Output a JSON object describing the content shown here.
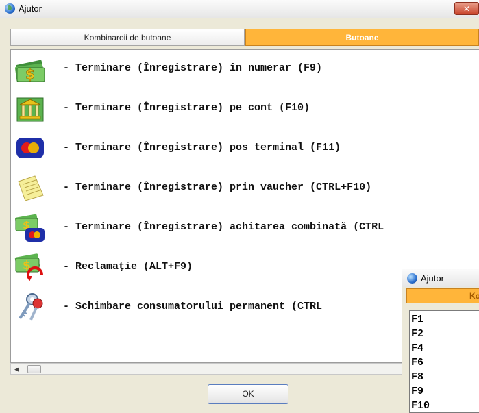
{
  "window": {
    "title": "Ajutor",
    "close_label": "✕"
  },
  "tabs": [
    {
      "label": "Kombinaroii de butoane",
      "active": false
    },
    {
      "label": "Butoane",
      "active": true
    }
  ],
  "rows": [
    {
      "icon": "cash-icon",
      "text": "- Terminare (Înregistrare) în numerar (F9)"
    },
    {
      "icon": "bank-icon",
      "text": "- Terminare (Înregistrare) pe cont (F10)"
    },
    {
      "icon": "card-icon",
      "text": "- Terminare (Înregistrare) pos terminal (F11)"
    },
    {
      "icon": "voucher-icon",
      "text": "- Terminare (Înregistrare) prin vaucher (CTRL+F10)"
    },
    {
      "icon": "combined-payment-icon",
      "text": "- Terminare (Înregistrare) achitarea combinată (CTRL"
    },
    {
      "icon": "refund-icon",
      "text": "- Reclamaţie (ALT+F9)"
    },
    {
      "icon": "keys-icon",
      "text": "- Schimbare consumatorului permanent (CTRL"
    }
  ],
  "ok_label": "OK",
  "colors": {
    "active_tab": "#ffb53a",
    "title_bar": "#f0f0f0"
  },
  "second_window": {
    "title": "Ajutor",
    "tab_label": "Ko",
    "items": [
      "F1",
      "F2",
      "F4",
      "F6",
      "F8",
      "F9",
      "F10"
    ]
  }
}
